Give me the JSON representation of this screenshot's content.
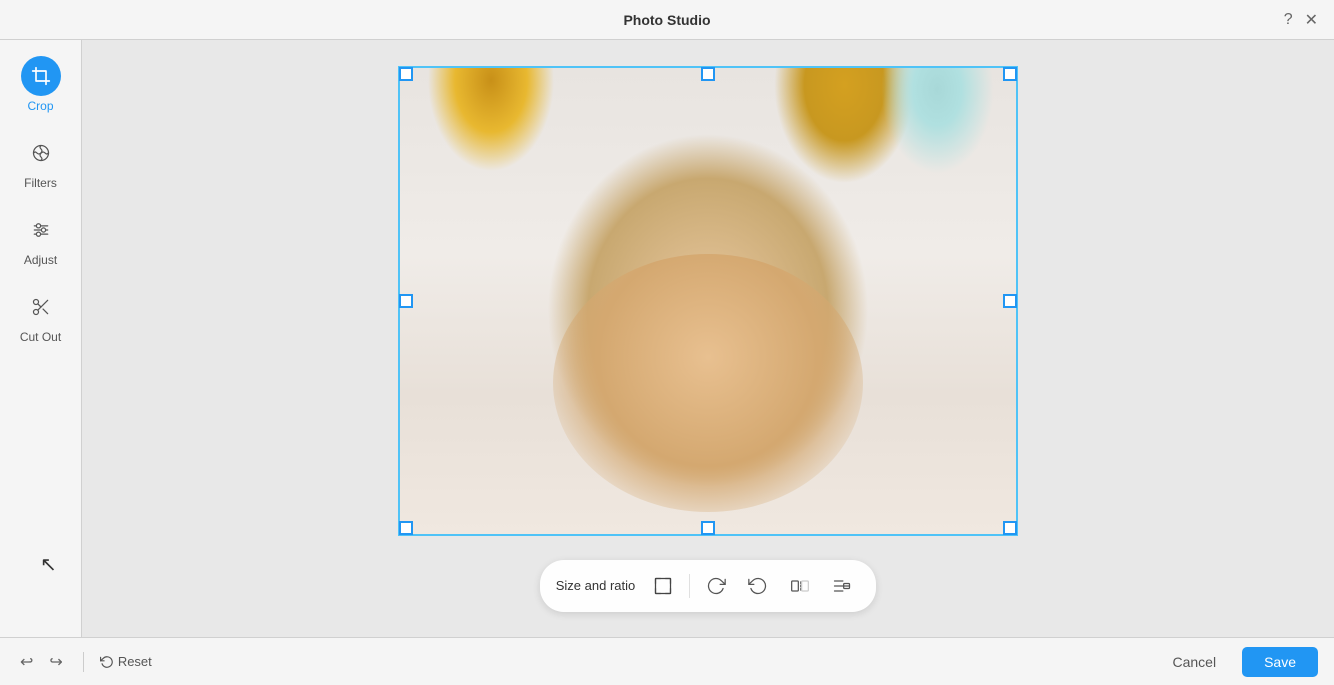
{
  "app": {
    "title": "Photo Studio"
  },
  "titlebar": {
    "help_label": "?",
    "close_label": "✕"
  },
  "sidebar": {
    "tools": [
      {
        "id": "crop",
        "label": "Crop",
        "active": true,
        "icon": "crop"
      },
      {
        "id": "filters",
        "label": "Filters",
        "active": false,
        "icon": "filters"
      },
      {
        "id": "adjust",
        "label": "Adjust",
        "active": false,
        "icon": "adjust"
      },
      {
        "id": "cutout",
        "label": "Cut Out",
        "active": false,
        "icon": "scissors"
      }
    ]
  },
  "toolbar": {
    "size_ratio_label": "Size and ratio",
    "rotate_right_title": "Rotate right",
    "rotate_left_title": "Rotate left",
    "flip_title": "Flip",
    "align_title": "Align"
  },
  "bottom": {
    "undo_label": "↩",
    "redo_label": "↪",
    "reset_label": "Reset",
    "cancel_label": "Cancel",
    "save_label": "Save"
  },
  "colors": {
    "accent": "#2196f3",
    "active_tool_bg": "#2196f3"
  }
}
